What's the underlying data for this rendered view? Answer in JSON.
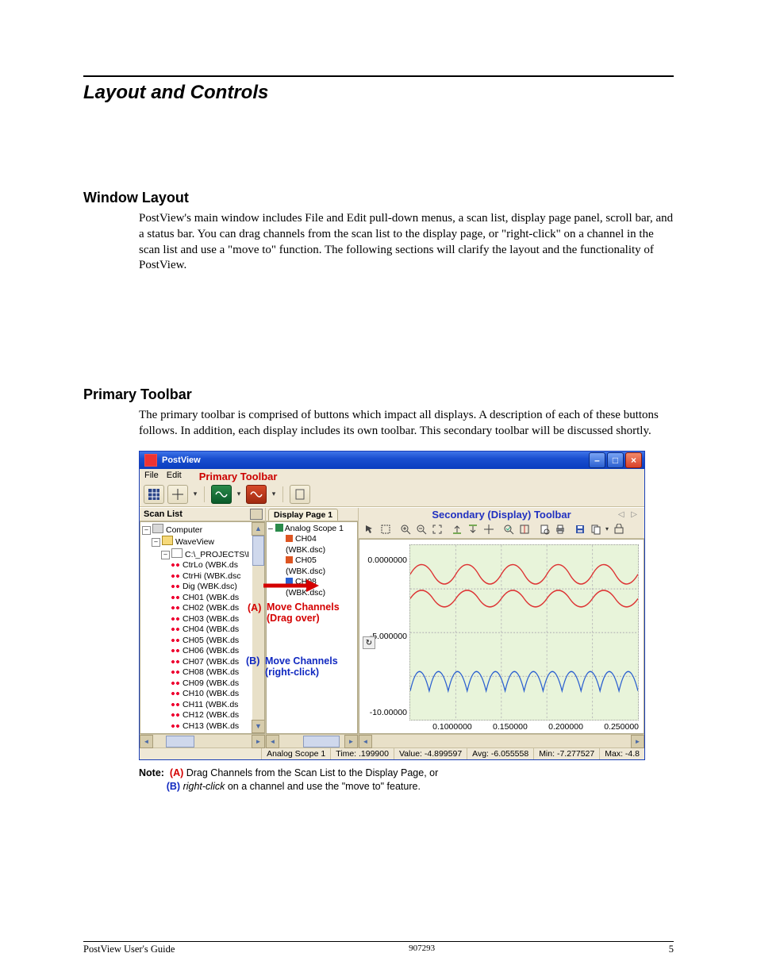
{
  "doc": {
    "section_title": "Layout and Controls",
    "h_window_layout": "Window Layout",
    "p_window_layout": "PostView's main window includes File and Edit pull-down menus, a scan list, display page panel, scroll bar, and a status bar.  You can drag channels from the scan list to the display page, or \"right-click\" on a channel in the scan list and use a \"move to\" function.  The following sections will clarify the layout and the functionality of PostView.",
    "h_primary_toolbar": "Primary Toolbar",
    "p_primary_toolbar": "The primary toolbar is comprised of buttons which impact all displays.  A description of each of these buttons follows.  In addition, each display includes its own toolbar.  This secondary toolbar will be discussed shortly.",
    "note_label": "Note:",
    "note_a_tag": "(A)",
    "note_a_text": " Drag Channels from the Scan List to the Display Page, or",
    "note_b_tag": "(B)",
    "note_b_text_i": "right-click",
    "note_b_text_r": " on a channel and use the \"move to\" feature."
  },
  "app": {
    "title": "PostView",
    "menu_file": "File",
    "menu_edit": "Edit",
    "label_primary_toolbar": "Primary Toolbar",
    "label_secondary_toolbar": "Secondary (Display) Toolbar",
    "scanlist_title": "Scan List",
    "display_tab": "Display Page 1",
    "anno_A": "(A)",
    "anno_A_l1": "Move Channels",
    "anno_A_l2": "(Drag over)",
    "anno_B": "(B)",
    "anno_B_l1": "Move Channels",
    "anno_B_l2": "(right-click)",
    "tree": {
      "root": "Computer",
      "l1": "WaveView",
      "l2": "C:\\_PROJECTS\\I",
      "items": [
        "CtrLo (WBK.ds",
        "CtrHi (WBK.dsc",
        "Dig (WBK.dsc)",
        "CH01 (WBK.ds",
        "CH02 (WBK.ds",
        "CH03 (WBK.ds",
        "CH04 (WBK.ds",
        "CH05 (WBK.ds",
        "CH06 (WBK.ds",
        "CH07 (WBK.ds",
        "CH08 (WBK.ds",
        "CH09 (WBK.ds",
        "CH10 (WBK.ds",
        "CH11 (WBK.ds",
        "CH12 (WBK.ds",
        "CH13 (WBK.ds"
      ]
    },
    "midtree": {
      "root": "Analog Scope 1",
      "items": [
        "CH04 (WBK.dsc)",
        "CH05 (WBK.dsc)",
        "CH08 (WBK.dsc)"
      ]
    },
    "yticks": [
      "0.0000000",
      "-5.000000",
      "-10.00000"
    ],
    "xticks": [
      "0.1000000",
      "0.150000",
      "0.200000",
      "0.250000"
    ],
    "status": {
      "name": "Analog Scope 1",
      "time": "Time: .199900",
      "value": "Value: -4.899597",
      "avg": "Avg: -6.055558",
      "min": "Min: -7.277527",
      "max": "Max: -4.8"
    }
  },
  "footer": {
    "left": "PostView User's Guide",
    "mid": "907293",
    "right": "5"
  }
}
